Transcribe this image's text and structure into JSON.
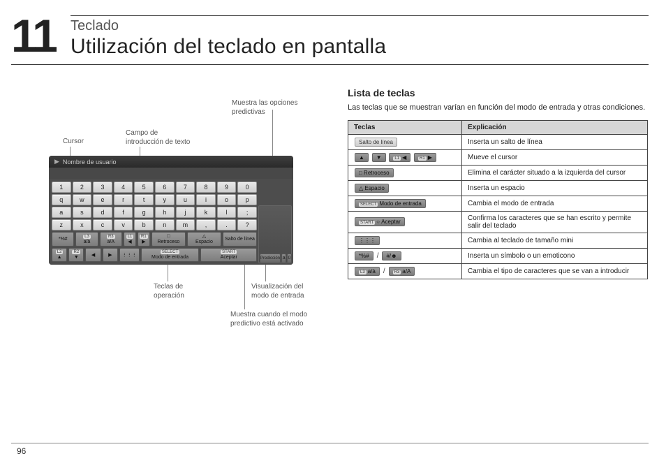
{
  "chapter": {
    "num": "11",
    "category": "Teclado",
    "title": "Utilización del teclado en pantalla"
  },
  "page": "96",
  "callouts": {
    "predictive_opts": "Muestra las opciones predictivas",
    "text_field_l1": "Campo de",
    "text_field_l2": "introducción de texto",
    "cursor": "Cursor",
    "op_keys_l1": "Teclas de",
    "op_keys_l2": "operación",
    "mode_view_l1": "Visualización del",
    "mode_view_l2": "modo de entrada",
    "pred_on_l1": "Muestra cuando el modo",
    "pred_on_l2": "predictivo está activado"
  },
  "keyboard": {
    "title": "Nombre de usuario",
    "rows": [
      [
        "1",
        "2",
        "3",
        "4",
        "5",
        "6",
        "7",
        "8",
        "9",
        "0"
      ],
      [
        "q",
        "w",
        "e",
        "r",
        "t",
        "y",
        "u",
        "i",
        "o",
        "p"
      ],
      [
        "a",
        "s",
        "d",
        "f",
        "g",
        "h",
        "j",
        "k",
        "l",
        ";"
      ],
      [
        "z",
        "x",
        "c",
        "v",
        "b",
        "n",
        "m",
        ",",
        ".",
        "?"
      ]
    ],
    "op": {
      "sym": "*%#",
      "l3": "L3",
      "r3": "R3",
      "aA1": "a/à",
      "aA2": "a/A",
      "l1": "L1",
      "r1": "R1",
      "back": "Retroceso",
      "space": "Espacio",
      "salto": "Salto de línea",
      "l2": "L2",
      "r2": "R2",
      "up": "▲",
      "left": "◀",
      "right": "▶",
      "down": "▼",
      "grid": "⋮⋮⋮",
      "select": "SELECT",
      "start": "START",
      "mode_l1": "Modo",
      "mode_l2": "de entrada",
      "accept": "Aceptar",
      "pred": "Predicción",
      "side_a": "a",
      "side_0": "0"
    }
  },
  "list": {
    "heading": "Lista de teclas",
    "intro": "Las teclas que se muestran varían en función del modo de entrada y otras condiciones.",
    "th1": "Teclas",
    "th2": "Explicación",
    "rows": [
      {
        "k": "salto",
        "e": "Inserta un salto de línea"
      },
      {
        "k": "cursor",
        "e": "Mueve el cursor"
      },
      {
        "k": "back",
        "e": "Elimina el carácter situado a la izquierda del cursor"
      },
      {
        "k": "space",
        "e": "Inserta un espacio"
      },
      {
        "k": "mode",
        "e": "Cambia el modo de entrada"
      },
      {
        "k": "accept",
        "e": "Confirma los caracteres que se han escrito y permite salir del teclado"
      },
      {
        "k": "grid",
        "e": "Cambia al teclado de tamaño mini"
      },
      {
        "k": "symface",
        "e": "Inserta un símbolo o un emoticono"
      },
      {
        "k": "case",
        "e": "Cambia el tipo de caracteres que se van a introducir"
      }
    ],
    "labels": {
      "salto": "Salto de línea",
      "l1": "L1",
      "r1": "R1",
      "back": "Retroceso",
      "space": "Espacio",
      "select": "SELECT",
      "mode": "Modo de entrada",
      "start": "START",
      "accept": "Aceptar",
      "sym": "*%#",
      "face": "#/☻",
      "l3": "L3",
      "r3": "R3",
      "aA1": "a/à",
      "aA2": "a/A",
      "up": "▲",
      "down": "▼",
      "left": "◀",
      "right": "▶",
      "sep": "/",
      "tri": "△",
      "circ": "○",
      "sq": "□"
    }
  }
}
